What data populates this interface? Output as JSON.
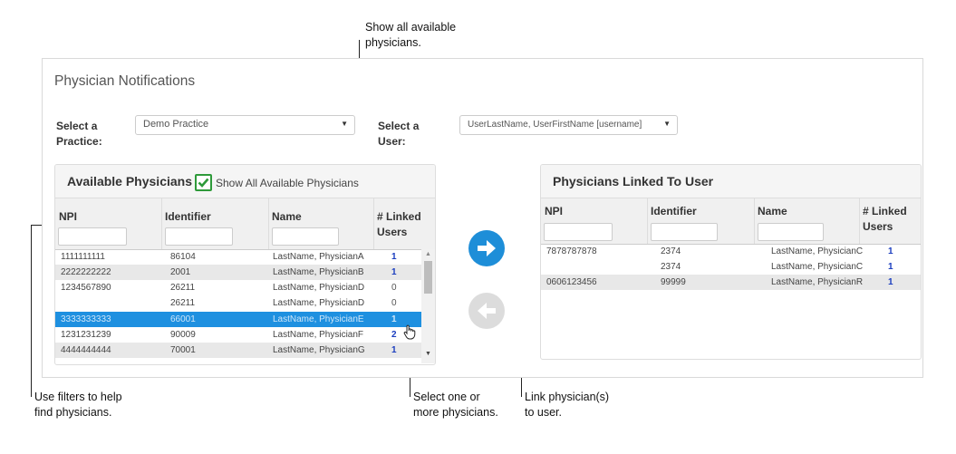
{
  "callouts": {
    "show_all": [
      "Show all available",
      "physicians."
    ],
    "filters": [
      "Use filters to help",
      "find physicians."
    ],
    "select": [
      "Select one or",
      "more physicians."
    ],
    "link": [
      "Link physician(s)",
      "to user."
    ]
  },
  "page": {
    "title": "Physician Notifications",
    "practice_label": [
      "Select a",
      "Practice:"
    ],
    "practice_value": "Demo Practice",
    "user_label": [
      "Select a",
      "User:"
    ],
    "user_value": "UserLastName, UserFirstName [username]"
  },
  "available": {
    "title": "Available Physicians",
    "show_all_label": "Show All Available Physicians",
    "show_all_checked": true,
    "columns": [
      "NPI",
      "Identifier",
      "Name",
      "# Linked",
      "Users"
    ],
    "rows": [
      {
        "npi": "1111111111",
        "id": "86104",
        "name": "LastName, PhysicianA",
        "count": "1",
        "style": "white"
      },
      {
        "npi": "2222222222",
        "id": "2001",
        "name": "LastName, PhysicianB",
        "count": "1",
        "style": "gray"
      },
      {
        "npi": "1234567890",
        "id": "26211",
        "name": "LastName, PhysicianD",
        "count": "0",
        "style": "white"
      },
      {
        "npi": "",
        "id": "26211",
        "name": "LastName, PhysicianD",
        "count": "0",
        "style": "white"
      },
      {
        "npi": "3333333333",
        "id": "66001",
        "name": "LastName, PhysicianE",
        "count": "1",
        "style": "sel"
      },
      {
        "npi": "1231231239",
        "id": "90009",
        "name": "LastName, PhysicianF",
        "count": "2",
        "style": "white"
      },
      {
        "npi": "4444444444",
        "id": "70001",
        "name": "LastName, PhysicianG",
        "count": "1",
        "style": "gray"
      }
    ]
  },
  "linked": {
    "title": "Physicians Linked To User",
    "columns": [
      "NPI",
      "Identifier",
      "Name",
      "# Linked",
      "Users"
    ],
    "rows": [
      {
        "npi": "7878787878",
        "id": "2374",
        "name": "LastName, PhysicianC",
        "count": "1",
        "style": "white"
      },
      {
        "npi": "",
        "id": "2374",
        "name": "LastName, PhysicianC",
        "count": "1",
        "style": "white"
      },
      {
        "npi": "0606123456",
        "id": "99999",
        "name": "LastName, PhysicianR",
        "count": "1",
        "style": "gray"
      }
    ]
  },
  "icons": {
    "link_button": "arrow-right-circle-icon",
    "unlink_button": "arrow-left-circle-icon",
    "checkbox": "check-icon",
    "cursor": "hand-pointer-icon"
  },
  "colors": {
    "accent": "#1e8ed8",
    "selected_row": "#1e90e0",
    "disabled": "#dcdcdc",
    "check": "#2e9a3a"
  }
}
